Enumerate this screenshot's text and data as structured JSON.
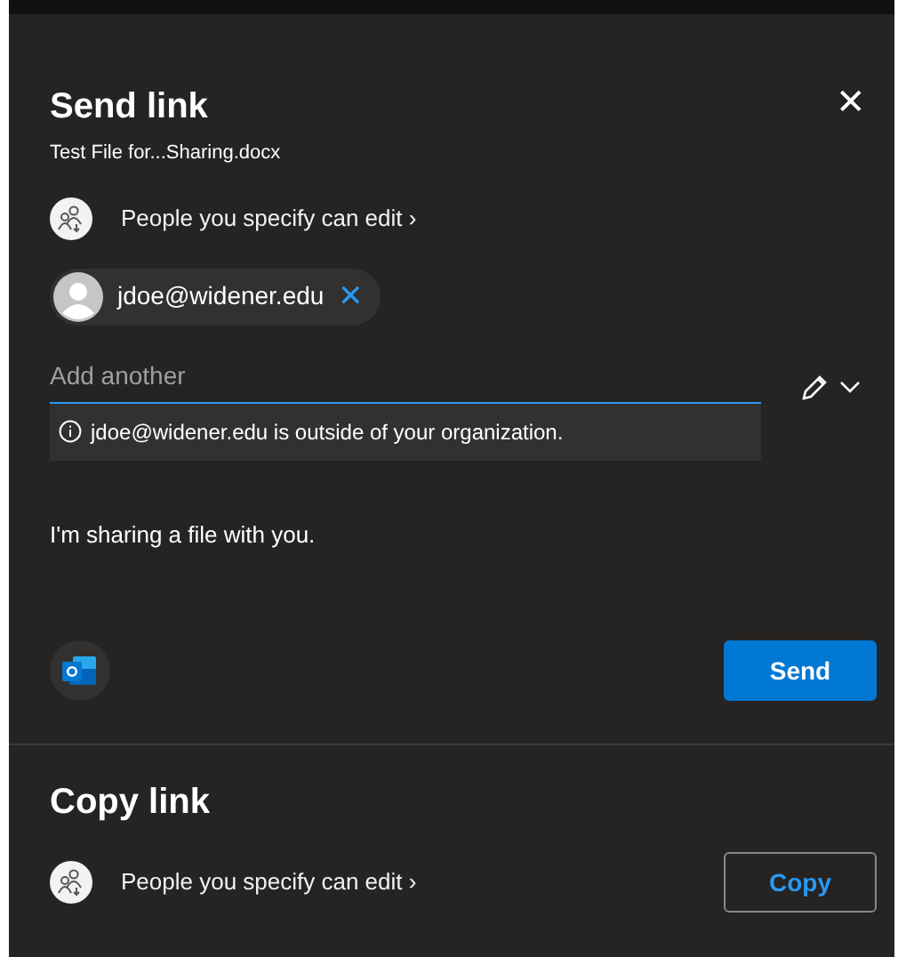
{
  "send_link": {
    "title": "Send link",
    "file_name": "Test File for...Sharing.docx",
    "close": "✕",
    "permission": "People you specify can edit ›",
    "recipients": [
      {
        "email": "jdoe@widener.edu",
        "remove": "✕"
      }
    ],
    "add_field": {
      "placeholder": "Add another"
    },
    "warning": "jdoe@widener.edu is outside of your organization.",
    "message": "I'm sharing a file with you.",
    "send_button": "Send"
  },
  "copy_link": {
    "title": "Copy link",
    "permission": "People you specify can edit ›",
    "copy_button": "Copy"
  }
}
